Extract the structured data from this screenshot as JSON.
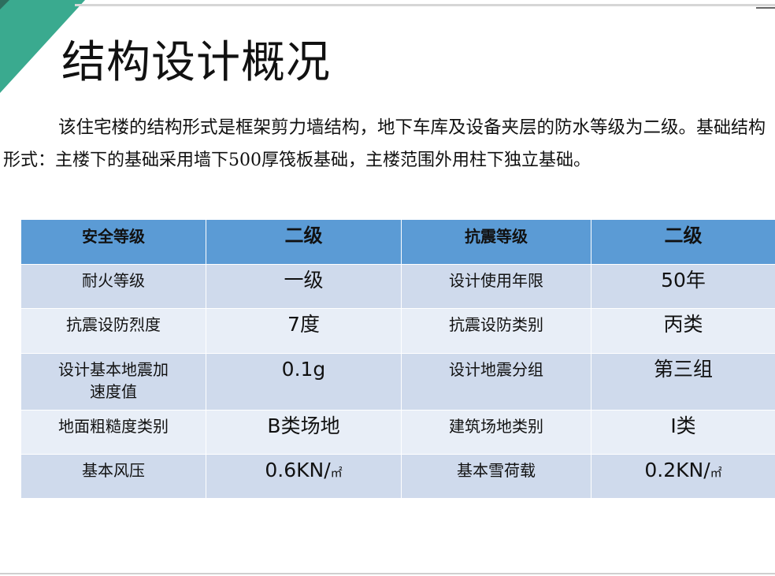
{
  "slide": {
    "title": "结构设计概况",
    "intro_part1": "该住宅楼的结构形式是框架剪力墙结构，地下车库及设备夹层的防水等级为二级。",
    "intro_part2": "基础结构形式：主楼下的基础采用墙下500厚筏板基础，主楼范围外用柱下独立基础。",
    "accent_color": "#3aaa8f",
    "header_color": "#5b9bd5"
  },
  "table": {
    "header": [
      "安全等级",
      "二级",
      "抗震等级",
      "二级"
    ],
    "rows": [
      [
        "耐火等级",
        "一级",
        "设计使用年限",
        "50年"
      ],
      [
        "抗震设防烈度",
        "7度",
        "抗震设防类别",
        "丙类"
      ],
      [
        "设计基本地震加速度值",
        "0.1g",
        "设计地震分组",
        "第三组"
      ],
      [
        "地面粗糙度类别",
        "B类场地",
        "建筑场地类别",
        "Ⅰ类"
      ]
    ],
    "last_row": {
      "label1": "基本风压",
      "value1_num": "0.6KN/",
      "value1_unit": "㎡",
      "label2": "基本雪荷载",
      "value2_num": "0.2KN/",
      "value2_unit": "㎡"
    }
  }
}
